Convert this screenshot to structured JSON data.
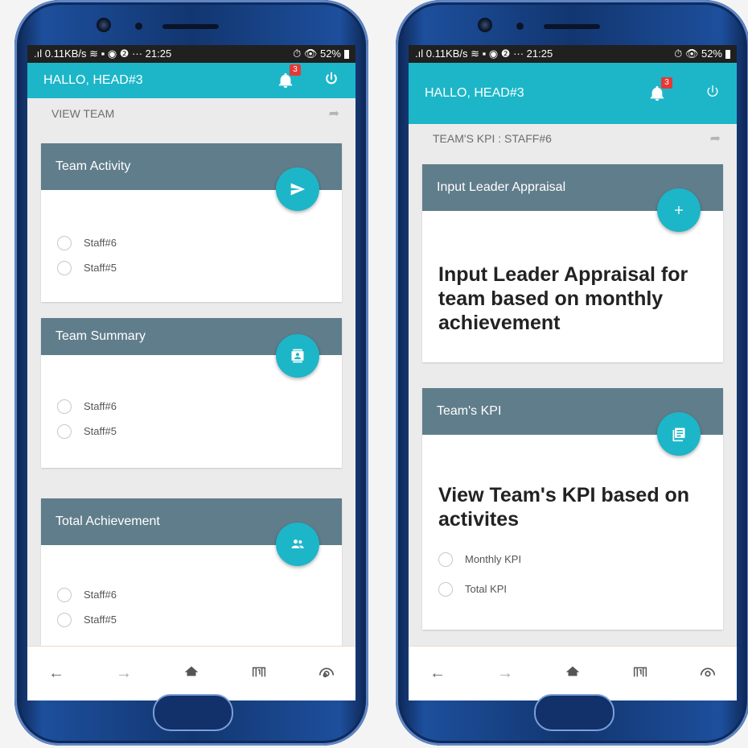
{
  "status": {
    "left": ".ıl 0.11KB/s ≋ ▪ ◉ ❷ ··· 21:25",
    "right": "⏱ 👁 52%"
  },
  "left": {
    "greeting": "HALLO, HEAD#3",
    "notification_count": "3",
    "subtitle": "VIEW TEAM",
    "cards": [
      {
        "title": "Team Activity",
        "icon": "send-icon",
        "items": [
          "Staff#6",
          "Staff#5"
        ]
      },
      {
        "title": "Team Summary",
        "icon": "contact-card-icon",
        "items": [
          "Staff#6",
          "Staff#5"
        ]
      },
      {
        "title": "Total Achievement",
        "icon": "people-icon",
        "items": [
          "Staff#6",
          "Staff#5"
        ]
      }
    ]
  },
  "right": {
    "greeting": "HALLO, HEAD#3",
    "notification_count": "3",
    "subtitle": "TEAM'S KPI : STAFF#6",
    "cards": [
      {
        "title": "Input Leader Appraisal",
        "icon": "plus-icon",
        "heading": "Input Leader Appraisal for team based on monthly achievement"
      },
      {
        "title": "Team's KPI",
        "icon": "list-icon",
        "heading": "View Team's KPI based on activites",
        "items": [
          "Monthly KPI",
          "Total KPI"
        ]
      }
    ]
  },
  "navbar": {
    "back": "←",
    "forward": "→",
    "home": "home-icon",
    "tabs": "tabs-icon",
    "reader": "reader-icon"
  },
  "colors": {
    "accent": "#1cb6c8",
    "card_header": "#607d8b",
    "badge": "#e53935"
  }
}
